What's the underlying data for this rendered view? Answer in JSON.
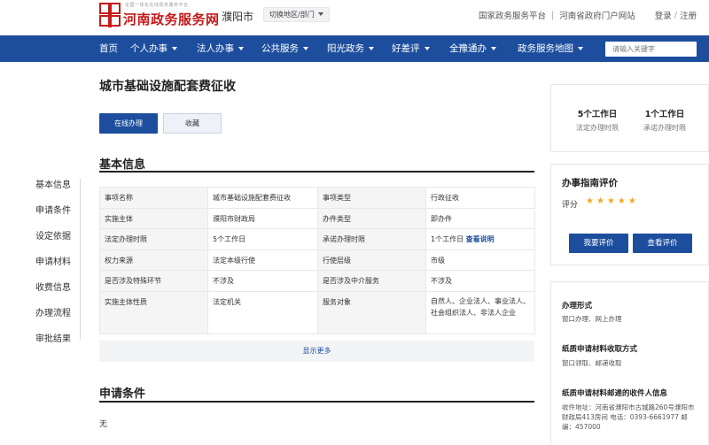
{
  "header": {
    "logo_small": "全国一体化在线政务服务平台",
    "logo_title": "河南政务服务网",
    "city": "濮阳市",
    "region_switch": "切换地区/部门",
    "links": [
      "国家政务服务平台",
      "河南省政府门户网站"
    ],
    "login": "登录",
    "register": "注册",
    "sep": "|",
    "sep_slash": "/"
  },
  "nav": {
    "items": [
      "首页",
      "个人办事",
      "法人办事",
      "公共服务",
      "阳光政务",
      "好差评",
      "全豫通办",
      "政务服务地图"
    ],
    "search_placeholder": "请输入关键字"
  },
  "main": {
    "title": "城市基础设施配套费征收",
    "btn_online": "在线办理",
    "btn_fav": "收藏",
    "section_basic": "基本信息",
    "section_cond": "申请条件",
    "cond_text": "无",
    "show_more": "显示更多"
  },
  "sidemenu": [
    "基本信息",
    "申请条件",
    "设定依据",
    "申请材料",
    "收费信息",
    "办理流程",
    "审批结果"
  ],
  "info": {
    "rows": [
      [
        "事项名称",
        "城市基础设施配套费征收",
        "事项类型",
        "行政征收"
      ],
      [
        "实施主体",
        "濮阳市财政局",
        "办件类型",
        "即办件"
      ],
      [
        "法定办理时限",
        "5个工作日",
        "承诺办理时限",
        "1个工作日"
      ],
      [
        "权力来源",
        "法定本级行使",
        "行使层级",
        "市级"
      ],
      [
        "是否涉及特殊环节",
        "不涉及",
        "是否涉及中介服务",
        "不涉及"
      ],
      [
        "实施主体性质",
        "法定机关",
        "服务对象",
        "自然人、企业法人、事业法人、社会组织法人、非法人企业"
      ]
    ],
    "link": "查看说明"
  },
  "right": {
    "stat1_num": "5个工作日",
    "stat1_lbl": "法定办理时限",
    "stat2_num": "1个工作日",
    "stat2_lbl": "承诺办理时限",
    "eval_title": "办事指南评价",
    "score_label": "评分",
    "stars": "★★★★★",
    "btn_eval": "我要评价",
    "btn_view": "查看评价",
    "way_title": "办理形式",
    "way_text": "窗口办理、网上办理",
    "paper_title": "纸质申请材料收取方式",
    "paper_text": "窗口领取、邮递收取",
    "addr_title": "纸质申请材料邮递的收件人信息",
    "addr_text": "收件地址：河南省濮阳市古城路260号濮阳市财政局413房间 电话：0393-6661977 邮编：457000"
  },
  "colors": {
    "brand_red": "#c41a1a",
    "nav_blue": "#1d4e9e",
    "star": "#f5a623"
  }
}
